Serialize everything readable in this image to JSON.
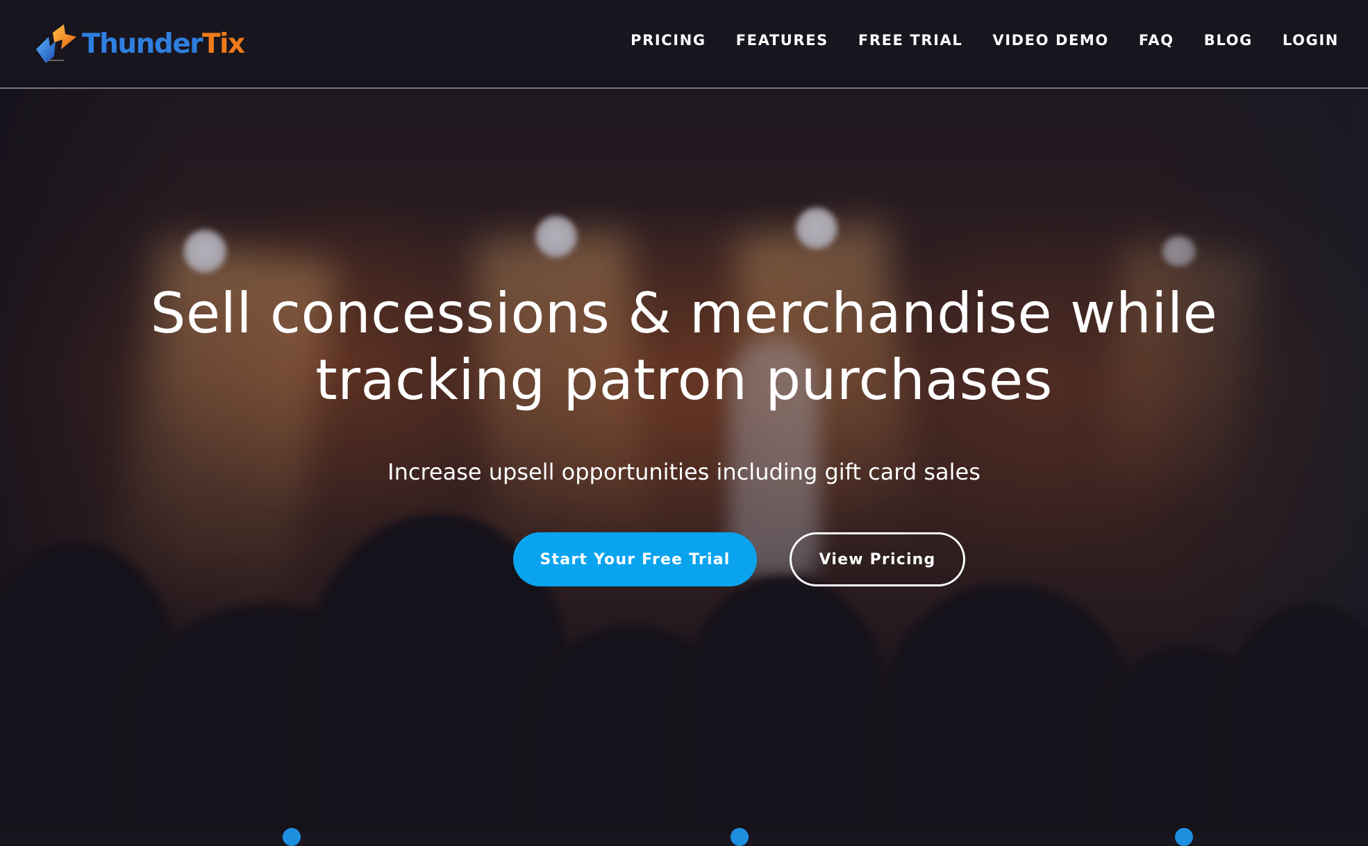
{
  "brand": {
    "name_part1": "Thunder",
    "name_part2": "Tix",
    "logo_icon": "lightning-ticket-logo-icon",
    "colors": {
      "blue": "#2f7fe0",
      "orange": "#f07a1a"
    }
  },
  "nav": {
    "items": [
      {
        "label": "PRICING"
      },
      {
        "label": "FEATURES"
      },
      {
        "label": "FREE TRIAL"
      },
      {
        "label": "VIDEO DEMO"
      },
      {
        "label": "FAQ"
      },
      {
        "label": "BLOG"
      },
      {
        "label": "LOGIN"
      }
    ]
  },
  "hero": {
    "headline_line1": "Sell concessions & merchandise while",
    "headline_line2": "tracking patron purchases",
    "subtitle": "Increase upsell opportunities including gift card sales",
    "primary_cta": "Start Your Free Trial",
    "secondary_cta": "View Pricing",
    "background_image": "stage-performance-photo",
    "colors": {
      "primary_cta_bg": "#0aa3ee",
      "header_bg": "#18151f"
    }
  }
}
